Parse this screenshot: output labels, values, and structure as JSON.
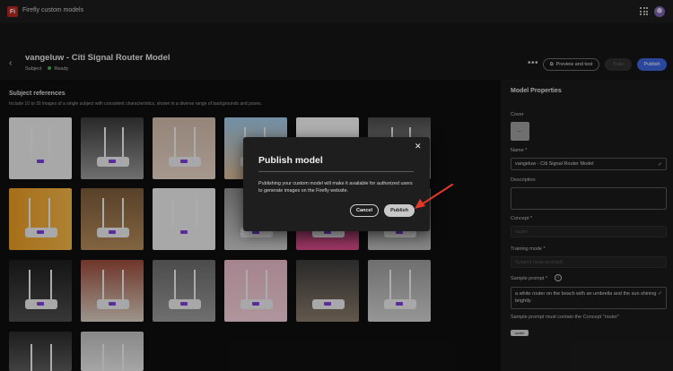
{
  "app": {
    "logo": "Fi",
    "title": "Firefly custom models"
  },
  "header": {
    "back_icon": "chevron-left-icon",
    "title": "vangeluw - Citi Signal Router Model",
    "type": "Subject",
    "status": "Ready",
    "more": "•••",
    "preview_label": "Preview and test",
    "train_label": "Train",
    "publish_label": "Publish"
  },
  "references": {
    "title": "Subject references",
    "subtitle": "Include 10 to 30 images of a single subject with consistent characteristics, shown in a diverse range of backgrounds and poses."
  },
  "properties": {
    "title": "Model Properties",
    "cover_label": "Cover",
    "name_label": "Name",
    "name_value": "vangeluw - Citi Signal Router Model",
    "description_label": "Description",
    "description_value": "",
    "concept_label": "Concept",
    "concept_value": "router",
    "training_mode_label": "Training mode",
    "training_mode_value": "Subject (auto-prompt)",
    "sample_prompt_label": "Sample prompt",
    "sample_prompt_value": "a white router on the beach with an umbrella and the sun shining brightly",
    "sample_prompt_note": "Sample prompt must contain the Concept \"router\"",
    "tag": "router"
  },
  "modal": {
    "title": "Publish model",
    "body": "Publishing your custom model will make it available for authorized users to generate images on the Firefly website.",
    "cancel_label": "Cancel",
    "publish_label": "Publish",
    "close_icon": "close-icon"
  },
  "colors": {
    "accent": "#3b63d9",
    "arrow": "#e0392b",
    "status": "#4caf50"
  }
}
